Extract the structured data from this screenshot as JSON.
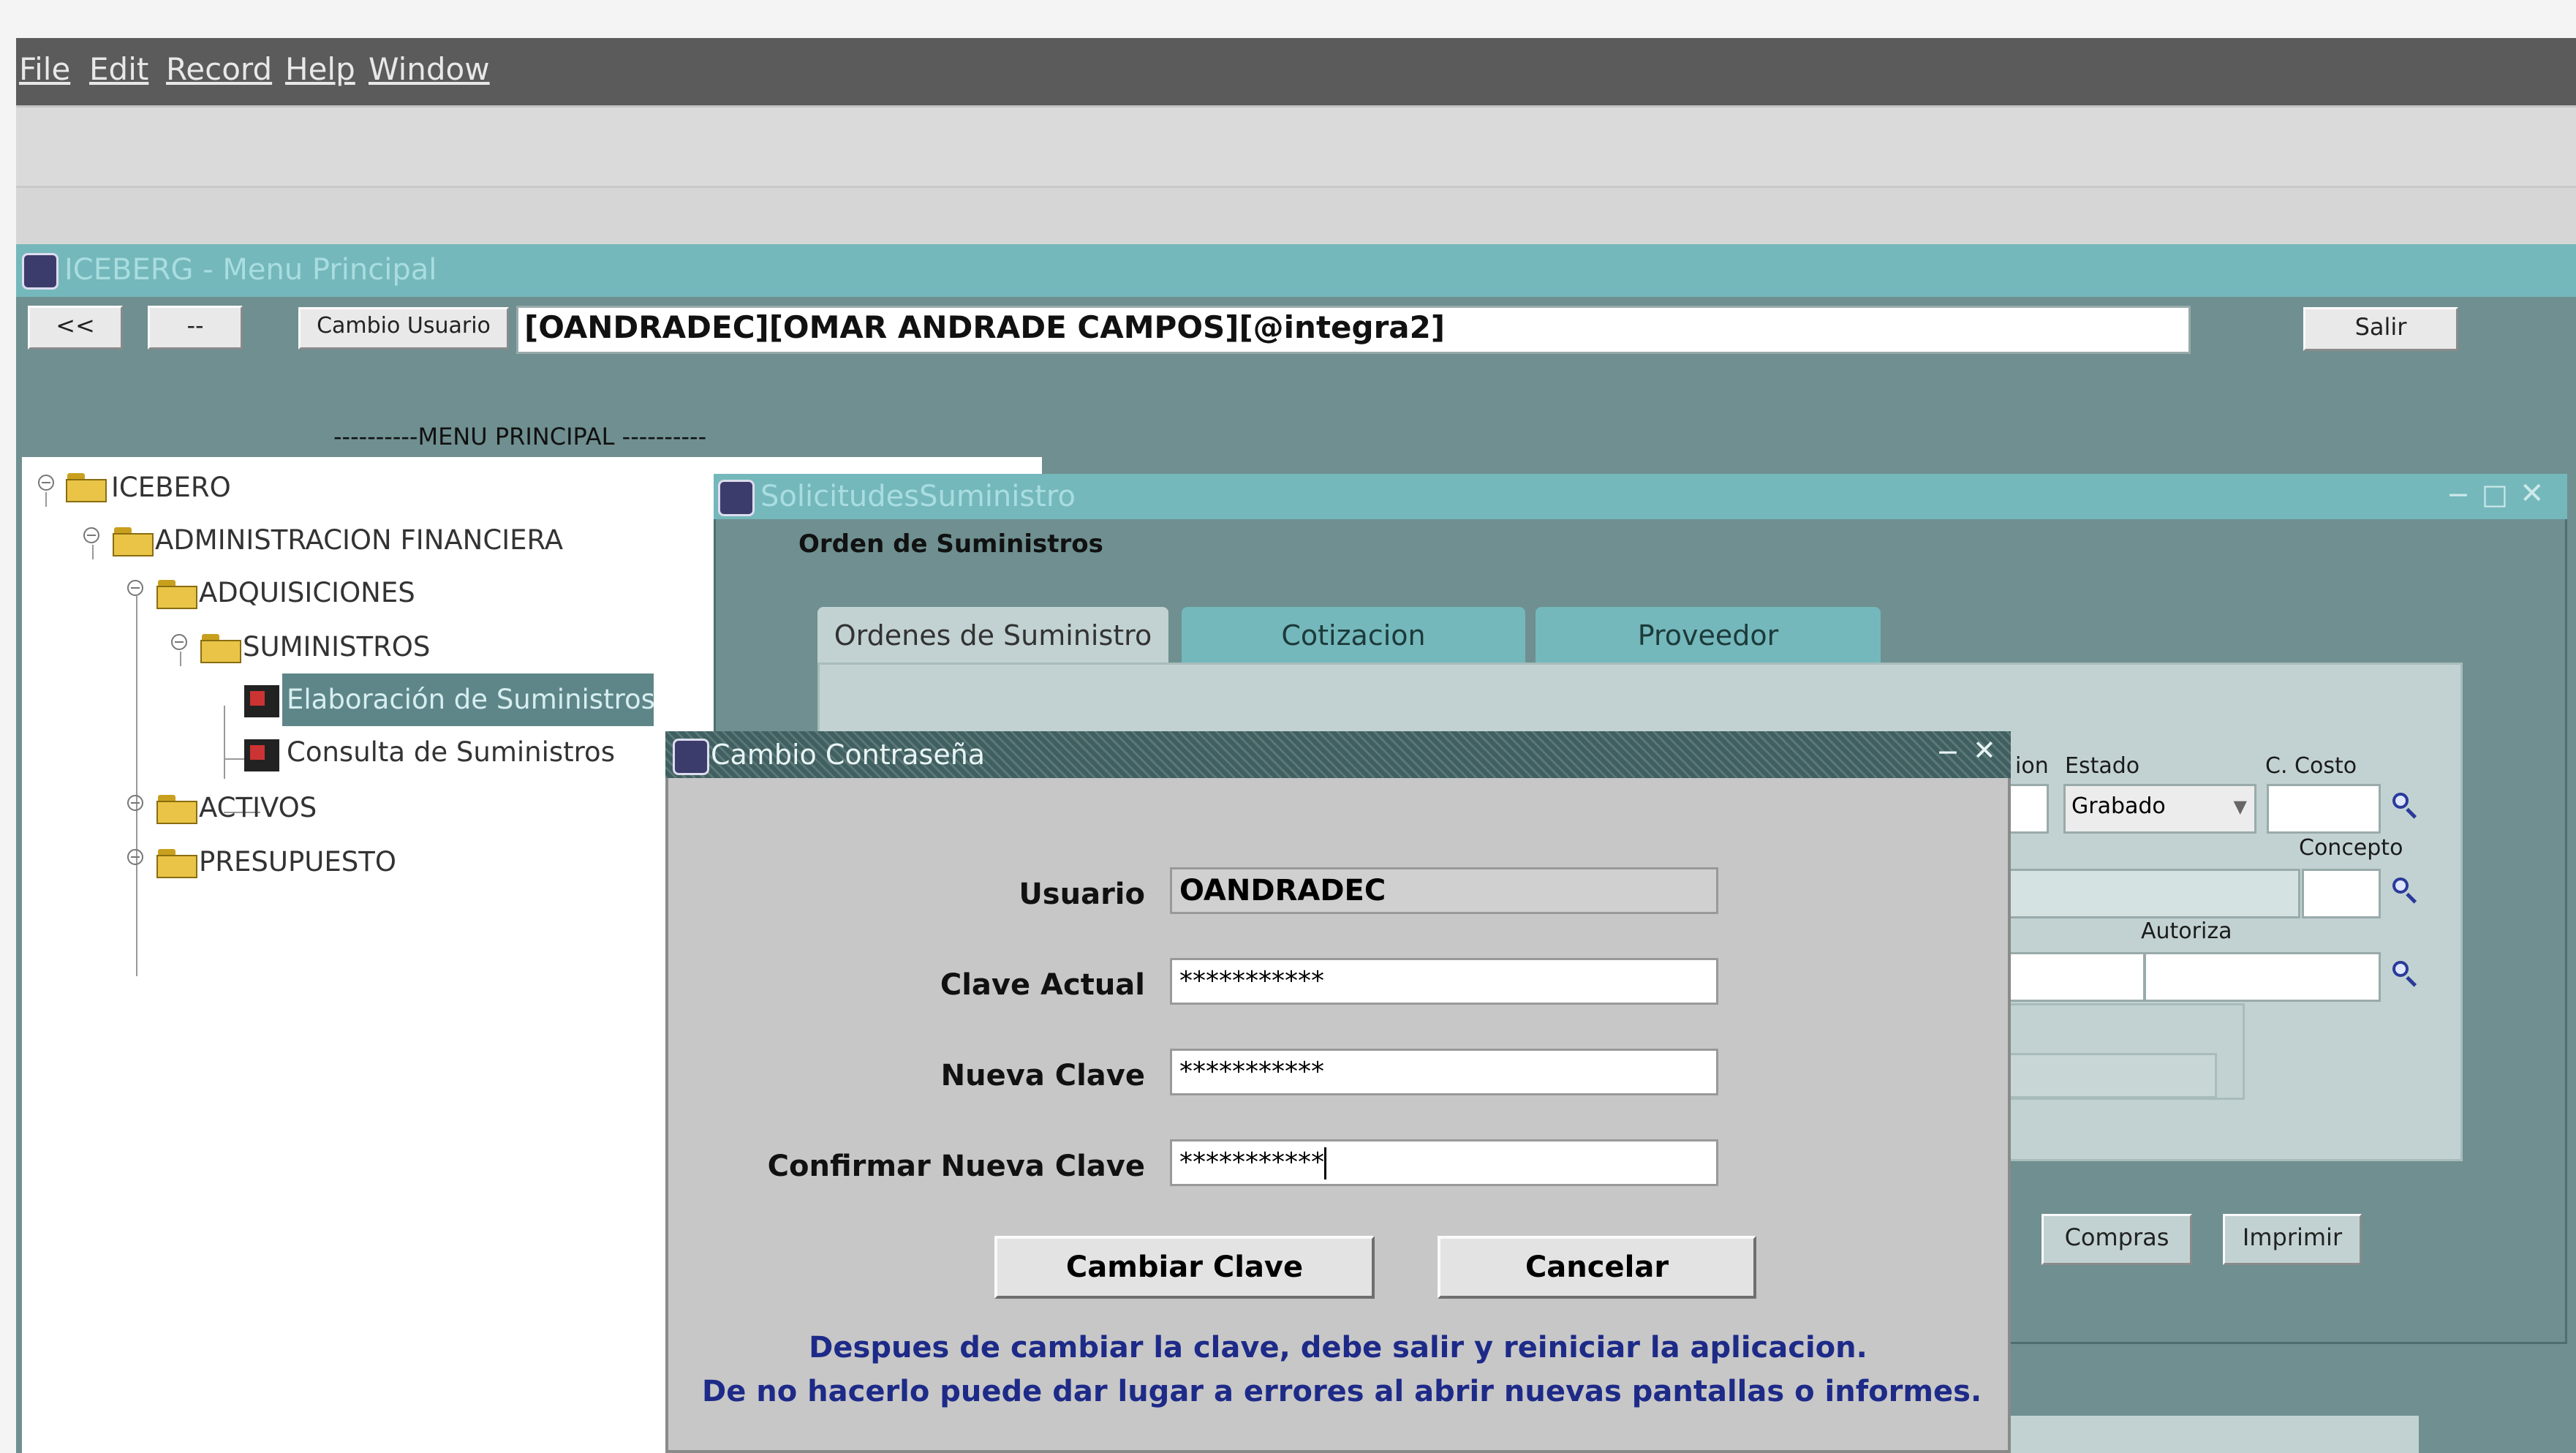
{
  "menu": [
    "File",
    "Edit",
    "Record",
    "Help",
    "Window"
  ],
  "main_window": {
    "title": "ICEBERG - Menu Principal",
    "prev_label": "<<",
    "next_label": "--",
    "cambio_usuario_label": "Cambio Usuario",
    "user_info": "[OANDRADEC][OMAR ANDRADE CAMPOS][@integra2]",
    "salir_label": "Salir",
    "menu_principal_header": "----------MENU PRINCIPAL ----------"
  },
  "tree": {
    "items": [
      "ICEBERO",
      "ADMINISTRACION FINANCIERA",
      "ADQUISICIONES",
      "SUMINISTROS",
      "Elaboración de Suministros",
      "Consulta de Suministros",
      "ACTIVOS",
      "PRESUPUESTO"
    ]
  },
  "solicitud_window": {
    "title": "SolicitudesSuministro",
    "heading": "Orden de Suministros",
    "tabs": [
      "Ordenes de Suministro",
      "Cotizacion",
      "Proveedor"
    ],
    "labels": {
      "estado": "Estado",
      "c_costo": "C. Costo",
      "concepto": "Concepto",
      "autoriza": "Autoriza",
      "ion_partial": "ion"
    },
    "estado_value": "Grabado",
    "compras_label": "Compras",
    "imprimir_label": "Imprimir"
  },
  "dialog": {
    "title": "Cambio Contraseña",
    "usuario_label": "Usuario",
    "usuario_value": "OANDRADEC",
    "clave_actual_label": "Clave Actual",
    "clave_actual_value": "***********",
    "nueva_clave_label": "Nueva  Clave",
    "nueva_clave_value": "***********",
    "confirmar_label": "Confirmar Nueva Clave",
    "confirmar_value": "***********",
    "cambiar_label": "Cambiar Clave",
    "cancelar_label": "Cancelar",
    "note_line1": "Despues de cambiar la clave, debe salir y reiniciar la aplicacion.",
    "note_line2": "De no hacerlo puede dar lugar a errores al abrir nuevas pantallas o informes."
  },
  "colors": {
    "title_bar": "#74b8bc",
    "workspace": "#6f8f90",
    "dialog_bg": "#c7c7c7",
    "note_text": "#1d2a88",
    "selected_item": "#5e8688"
  }
}
